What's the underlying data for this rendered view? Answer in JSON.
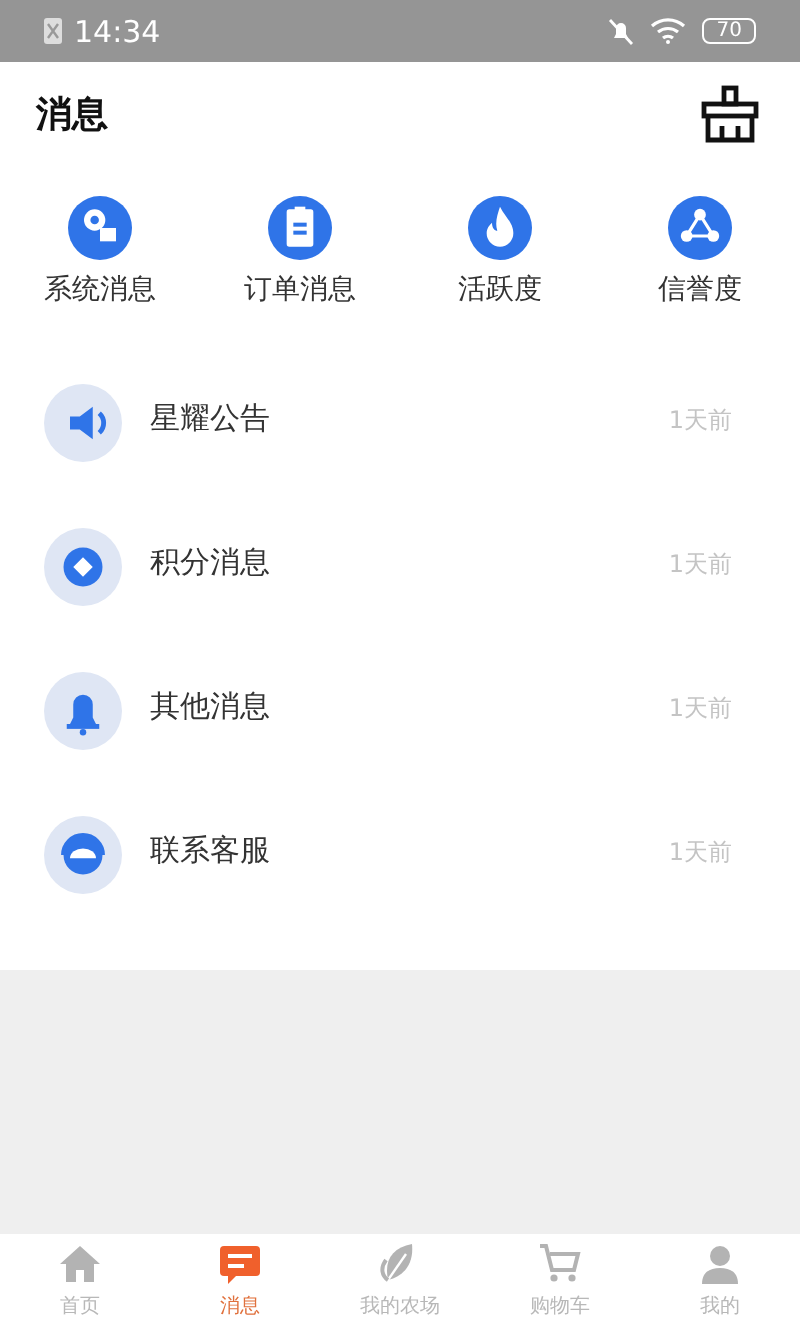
{
  "status_bar": {
    "time": "14:34",
    "battery": "70"
  },
  "header": {
    "title": "消息"
  },
  "categories": [
    {
      "label": "系统消息"
    },
    {
      "label": "订单消息"
    },
    {
      "label": "活跃度"
    },
    {
      "label": "信誉度"
    }
  ],
  "messages": [
    {
      "title": "星耀公告",
      "time": "1天前"
    },
    {
      "title": "积分消息",
      "time": "1天前"
    },
    {
      "title": "其他消息",
      "time": "1天前"
    },
    {
      "title": "联系客服",
      "time": "1天前"
    }
  ],
  "tab_bar": [
    {
      "label": "首页",
      "selected": false
    },
    {
      "label": "消息",
      "selected": true
    },
    {
      "label": "我的农场",
      "selected": false
    },
    {
      "label": "购物车",
      "selected": false
    },
    {
      "label": "我的",
      "selected": false
    }
  ]
}
